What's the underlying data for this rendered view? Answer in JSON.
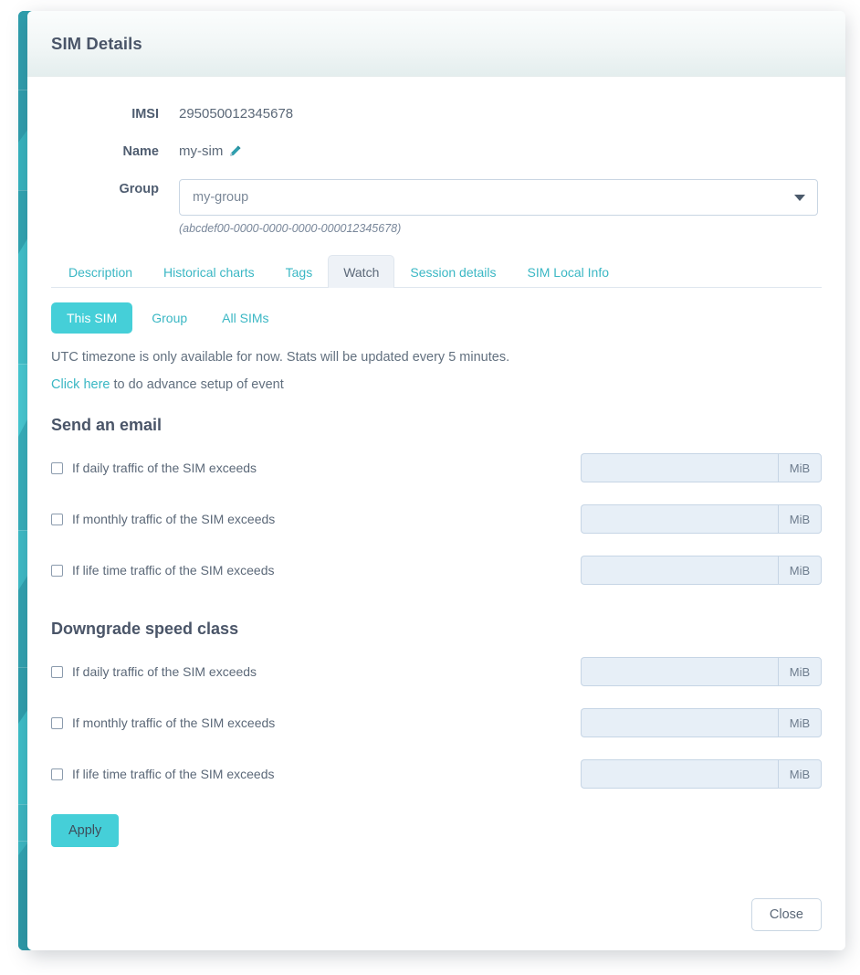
{
  "colors": {
    "accent_teal": "#45cfd8",
    "link_teal": "#3ab7c4",
    "strip_teal": "#2aa7b4",
    "text_dark": "#4a5568",
    "text_muted": "#5b6878",
    "input_fill": "#e7eff7",
    "active_tab_fill": "#eef2f7"
  },
  "modal": {
    "title": "SIM Details",
    "close_label": "Close"
  },
  "details": {
    "imsi_label": "IMSI",
    "imsi_value": "295050012345678",
    "name_label": "Name",
    "name_value": "my-sim",
    "edit_icon": "pencil-icon",
    "group_label": "Group",
    "group_value": "my-group",
    "group_uuid": "(abcdef00-0000-0000-0000-000012345678)",
    "dropdown_icon": "chevron-down-icon"
  },
  "tabs": [
    {
      "label": "Description",
      "active": false
    },
    {
      "label": "Historical charts",
      "active": false
    },
    {
      "label": "Tags",
      "active": false
    },
    {
      "label": "Watch",
      "active": true
    },
    {
      "label": "Session details",
      "active": false
    },
    {
      "label": "SIM Local Info",
      "active": false
    }
  ],
  "scope_pills": [
    {
      "label": "This SIM",
      "active": true
    },
    {
      "label": "Group",
      "active": false
    },
    {
      "label": "All SIMs",
      "active": false
    }
  ],
  "watch": {
    "note": "UTC timezone is only available for now. Stats will be updated every 5 minutes.",
    "link_text": "Click here",
    "link_suffix": "to do advance setup of event",
    "apply_label": "Apply",
    "sections": [
      {
        "title": "Send an email",
        "rows": [
          {
            "label": "If daily traffic of the SIM exceeds",
            "checked": false,
            "value": "",
            "unit": "MiB"
          },
          {
            "label": "If monthly traffic of the SIM exceeds",
            "checked": false,
            "value": "",
            "unit": "MiB"
          },
          {
            "label": "If life time traffic of the SIM exceeds",
            "checked": false,
            "value": "",
            "unit": "MiB"
          }
        ]
      },
      {
        "title": "Downgrade speed class",
        "rows": [
          {
            "label": "If daily traffic of the SIM exceeds",
            "checked": false,
            "value": "",
            "unit": "MiB"
          },
          {
            "label": "If monthly traffic of the SIM exceeds",
            "checked": false,
            "value": "",
            "unit": "MiB"
          },
          {
            "label": "If life time traffic of the SIM exceeds",
            "checked": false,
            "value": "",
            "unit": "MiB"
          }
        ]
      }
    ]
  }
}
